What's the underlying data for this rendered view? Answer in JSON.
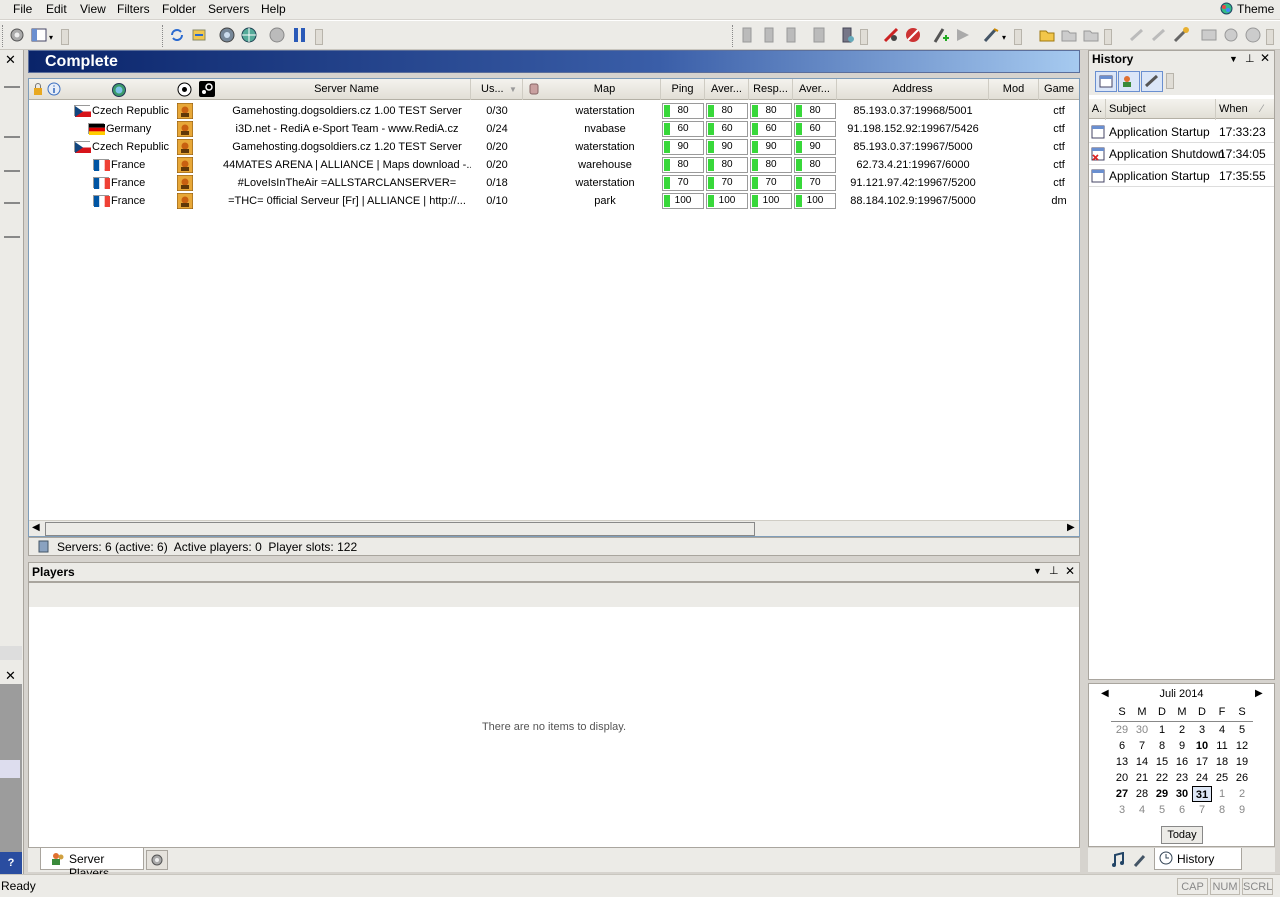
{
  "menu": {
    "file": "File",
    "edit": "Edit",
    "view": "View",
    "filters": "Filters",
    "folder": "Folder",
    "servers": "Servers",
    "help": "Help",
    "theme": "Theme"
  },
  "server_pane": {
    "title": "Complete",
    "columns": {
      "server_name": "Server Name",
      "users": "Us...",
      "map": "Map",
      "ping": "Ping",
      "aver1": "Aver...",
      "resp": "Resp...",
      "aver2": "Aver...",
      "address": "Address",
      "mod": "Mod",
      "game": "Game"
    },
    "rows": [
      {
        "country": "Czech Republic",
        "flag": "cz",
        "name": "Gamehosting.dogsoldiers.cz 1.00 TEST Server",
        "users": "0/30",
        "map": "waterstation",
        "ping": "80",
        "aver": "80",
        "resp": "80",
        "aver2": "80",
        "address": "85.193.0.37:19968/5001",
        "game": "ctf"
      },
      {
        "country": "Germany",
        "flag": "de",
        "name": "i3D.net - RediA e-Sport Team - www.RediA.cz",
        "users": "0/24",
        "map": "nvabase",
        "ping": "60",
        "aver": "60",
        "resp": "60",
        "aver2": "60",
        "address": "91.198.152.92:19967/5426",
        "game": "ctf"
      },
      {
        "country": "Czech Republic",
        "flag": "cz",
        "name": "Gamehosting.dogsoldiers.cz 1.20 TEST Server",
        "users": "0/20",
        "map": "waterstation",
        "ping": "90",
        "aver": "90",
        "resp": "90",
        "aver2": "90",
        "address": "85.193.0.37:19967/5000",
        "game": "ctf"
      },
      {
        "country": "France",
        "flag": "fr",
        "name": "44MATES ARENA | ALLIANCE | Maps download -...",
        "users": "0/20",
        "map": "warehouse",
        "ping": "80",
        "aver": "80",
        "resp": "80",
        "aver2": "80",
        "address": "62.73.4.21:19967/6000",
        "game": "ctf"
      },
      {
        "country": "France",
        "flag": "fr",
        "name": "#LoveIsInTheAir =ALLSTARCLANSERVER=",
        "users": "0/18",
        "map": "waterstation",
        "ping": "70",
        "aver": "70",
        "resp": "70",
        "aver2": "70",
        "address": "91.121.97.42:19967/5200",
        "game": "ctf"
      },
      {
        "country": "France",
        "flag": "fr",
        "name": "=THC= 0fficial Serveur [Fr] | ALLIANCE | http://...",
        "users": "0/10",
        "map": "park",
        "ping": "100",
        "aver": "100",
        "resp": "100",
        "aver2": "100",
        "address": "88.184.102.9:19967/5000",
        "game": "dm"
      }
    ],
    "status": "Servers: 6 (active: 6)  Active players: 0  Player slots: 122"
  },
  "players_pane": {
    "title": "Players",
    "empty": "There are no items to display."
  },
  "bottom_tabs": {
    "server_players": "Server Players"
  },
  "history": {
    "title": "History",
    "columns": {
      "a": "A.",
      "subject": "Subject",
      "when": "When"
    },
    "rows": [
      {
        "subject": "Application Startup",
        "when": "17:33:23"
      },
      {
        "subject": "Application Shutdown",
        "when": "17:34:05"
      },
      {
        "subject": "Application Startup",
        "when": "17:35:55"
      }
    ],
    "tab": "History"
  },
  "calendar": {
    "month": "Juli 2014",
    "weekdays": [
      "S",
      "M",
      "D",
      "M",
      "D",
      "F",
      "S"
    ],
    "weeks": [
      [
        "29",
        "30",
        "1",
        "2",
        "3",
        "4",
        "5"
      ],
      [
        "6",
        "7",
        "8",
        "9",
        "10",
        "11",
        "12"
      ],
      [
        "13",
        "14",
        "15",
        "16",
        "17",
        "18",
        "19"
      ],
      [
        "20",
        "21",
        "22",
        "23",
        "24",
        "25",
        "26"
      ],
      [
        "27",
        "28",
        "29",
        "30",
        "31",
        "1",
        "2"
      ],
      [
        "3",
        "4",
        "5",
        "6",
        "7",
        "8",
        "9"
      ]
    ],
    "today_label": "Today"
  },
  "statusbar": {
    "ready": "Ready",
    "cap": "CAP",
    "num": "NUM",
    "scrl": "SCRL"
  },
  "colors": {
    "ping_green": "#38d83a",
    "title_blue": "#0a246a"
  }
}
